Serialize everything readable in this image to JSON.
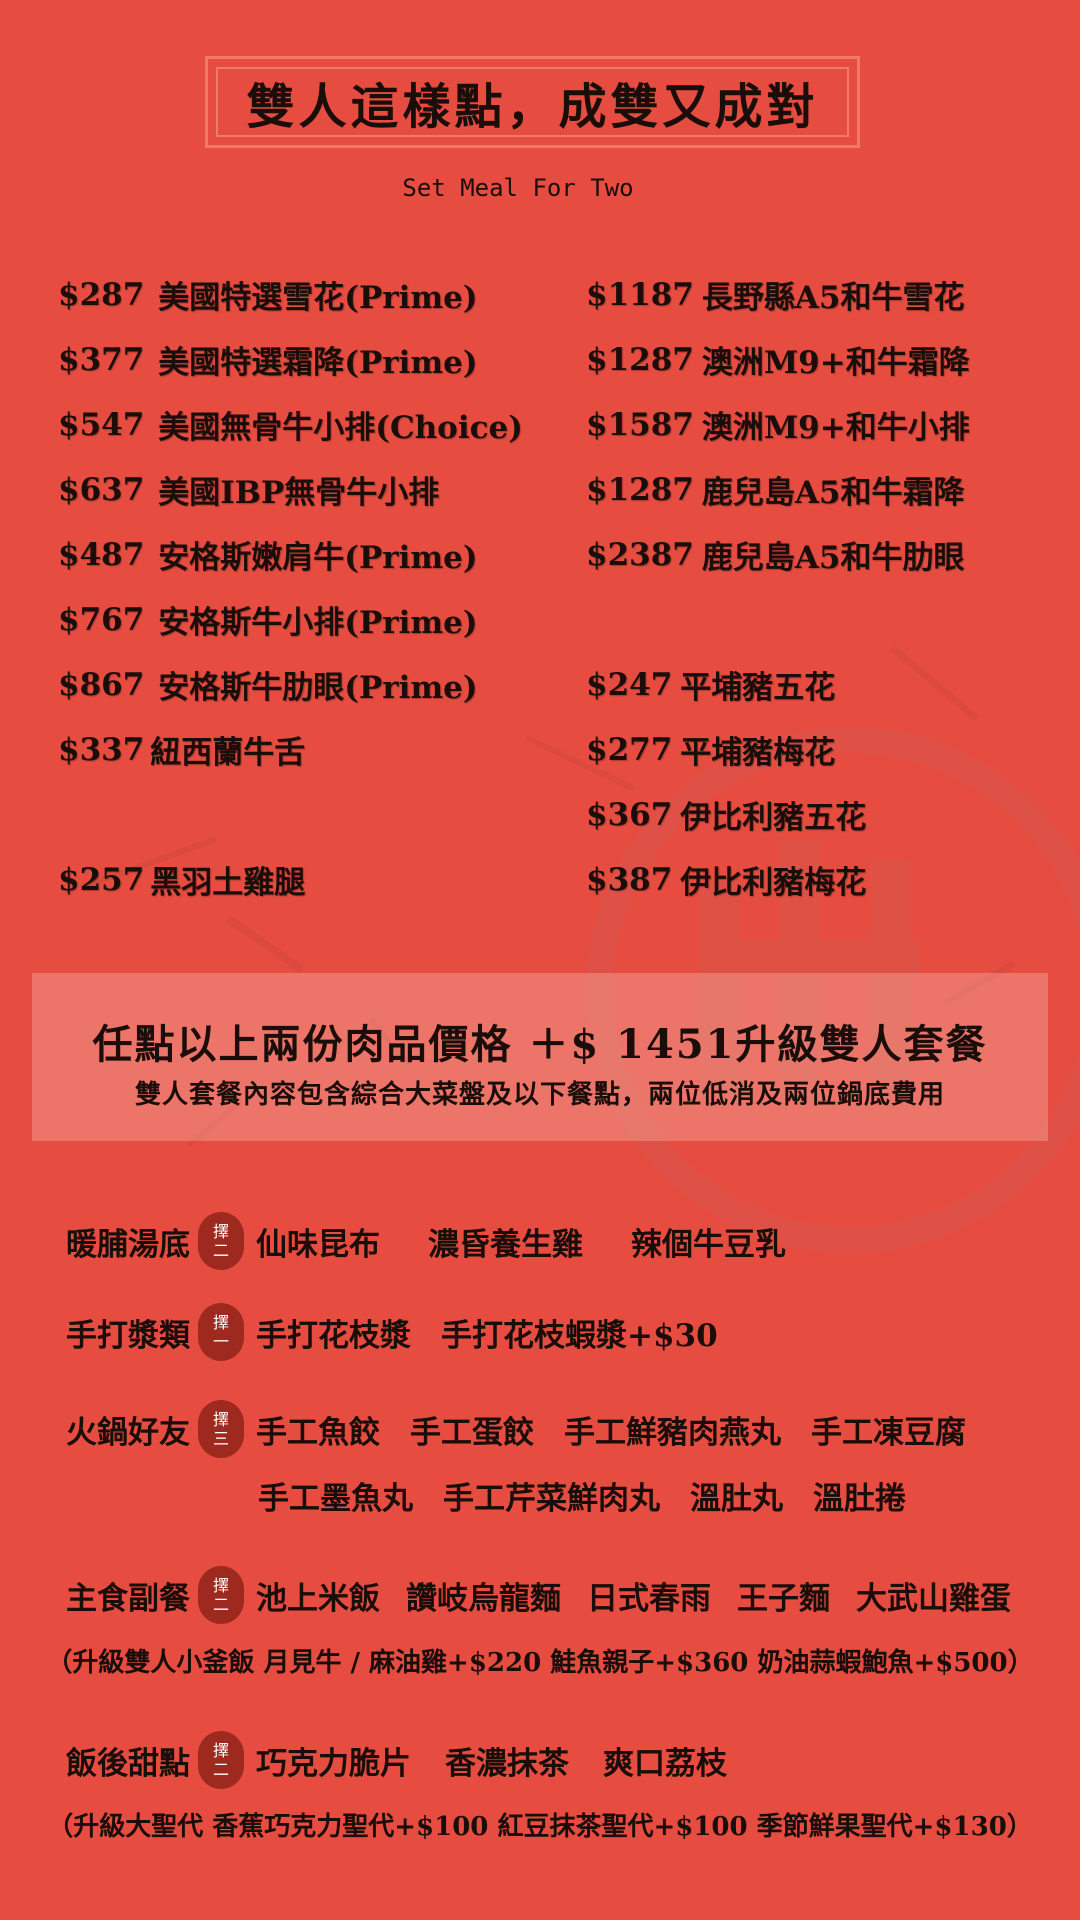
{
  "header": {
    "title": "雙人這樣點，成雙又成對",
    "subtitle": "Set Meal For Two"
  },
  "menu": {
    "left_column": [
      {
        "price": "$287",
        "name": "美國特選雪花(Prime)"
      },
      {
        "price": "$377",
        "name": "美國特選霜降(Prime)"
      },
      {
        "price": "$547",
        "name": "美國無骨牛小排(Choice)"
      },
      {
        "price": "$637",
        "name": "美國IBP無骨牛小排"
      },
      {
        "price": "$487",
        "name": "安格斯嫩肩牛(Prime)"
      },
      {
        "price": "$767",
        "name": "安格斯牛小排(Prime)"
      },
      {
        "price": "$867",
        "name": "安格斯牛肋眼(Prime)"
      },
      {
        "price": "$337",
        "name": "紐西蘭牛舌"
      },
      {
        "price": "",
        "name": ""
      },
      {
        "price": "$257",
        "name": "黑羽土雞腿"
      }
    ],
    "right_column": [
      {
        "price": "$1187",
        "name": "長野縣A5和牛雪花"
      },
      {
        "price": "$1287",
        "name": "澳洲M9+和牛霜降"
      },
      {
        "price": "$1587",
        "name": "澳洲M9+和牛小排"
      },
      {
        "price": "$1287",
        "name": "鹿兒島A5和牛霜降"
      },
      {
        "price": "$2387",
        "name": "鹿兒島A5和牛肋眼"
      },
      {
        "price": "",
        "name": ""
      },
      {
        "price": "$247",
        "name": "平埔豬五花"
      },
      {
        "price": "$277",
        "name": "平埔豬梅花"
      },
      {
        "price": "$367",
        "name": "伊比利豬五花"
      },
      {
        "price": "$387",
        "name": "伊比利豬梅花"
      }
    ]
  },
  "upgrade": {
    "headline": "任點以上兩份肉品價格 ＋$ 1451升級雙人套餐",
    "detail": "雙人套餐內容包含綜合大菜盤及以下餐點，兩位低消及兩位鍋底費用"
  },
  "set_items": {
    "soup": {
      "label": "暖脯湯底",
      "badge": [
        "擇",
        "二"
      ],
      "options": [
        "仙味昆布",
        "濃昏養生雞",
        "辣個牛豆乳"
      ]
    },
    "paste": {
      "label": "手打漿類",
      "badge": [
        "擇",
        "一"
      ],
      "options": [
        "手打花枝漿",
        "手打花枝蝦漿+$30"
      ]
    },
    "hotpot": {
      "label": "火鍋好友",
      "badge": [
        "擇",
        "三"
      ],
      "options": [
        "手工魚餃",
        "手工蛋餃",
        "手工鮮豬肉燕丸",
        "手工凍豆腐"
      ],
      "options_line2": [
        "手工墨魚丸",
        "手工芹菜鮮肉丸",
        "溫肚丸",
        "溫肚捲"
      ]
    },
    "staple": {
      "label": "主食副餐",
      "badge": [
        "擇",
        "二"
      ],
      "options": [
        "池上米飯",
        "讚岐烏龍麵",
        "日式春雨",
        "王子麵",
        "大武山雞蛋"
      ],
      "note": "（升級雙人小釜飯  月見牛 / 麻油雞+$220  鮭魚親子+$360  奶油蒜蝦鮑魚+$500）"
    },
    "dessert": {
      "label": "飯後甜點",
      "badge": [
        "擇",
        "二"
      ],
      "options": [
        "巧克力脆片",
        "香濃抹茶",
        "爽口荔枝"
      ],
      "note": "（升級大聖代  香蕉巧克力聖代+$100  紅豆抹茶聖代+$100  季節鮮果聖代+$130）"
    }
  },
  "colors": {
    "background": "#e64d40",
    "badge": "#9e2a1f",
    "text": "#1a0d0a",
    "frame": "#f07a62"
  }
}
